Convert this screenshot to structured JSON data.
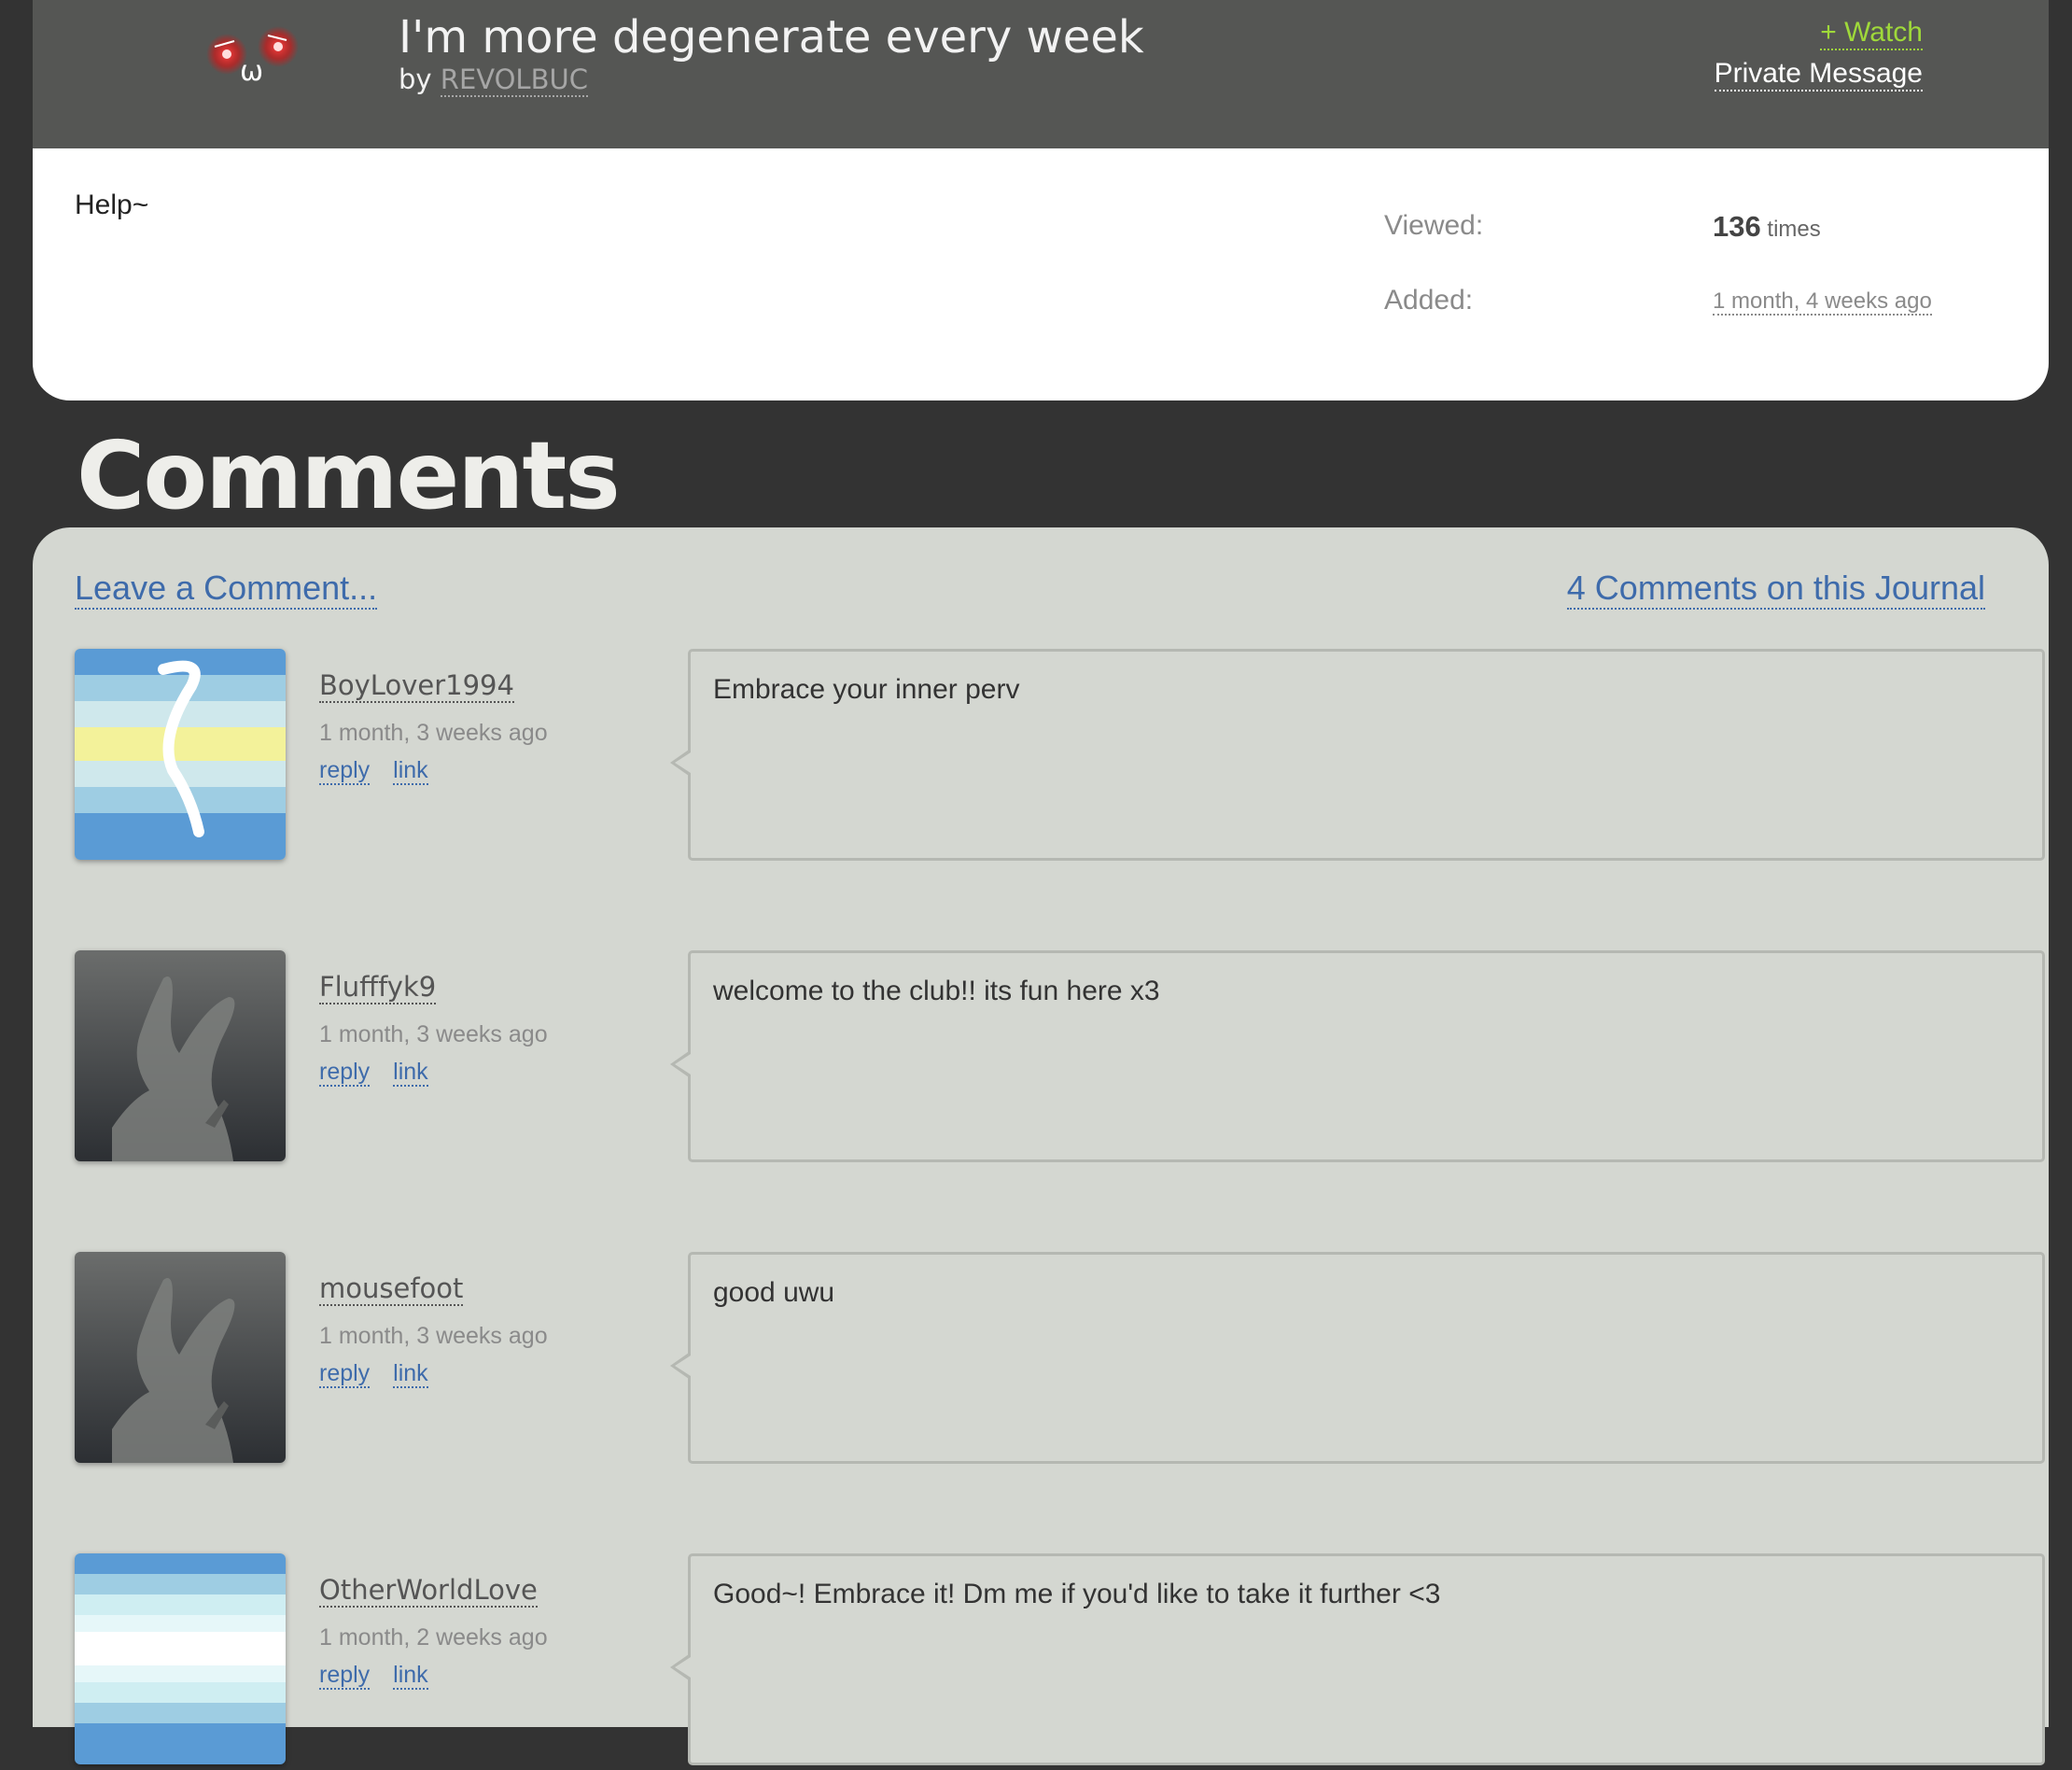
{
  "journal": {
    "title": "I'm more degenerate every week",
    "by_label": "by",
    "author": "REVOLBUC",
    "watch_label": "+ Watch",
    "pm_label": "Private Message",
    "body": "Help~",
    "viewed_label": "Viewed:",
    "viewed_count": "136",
    "viewed_unit": "times",
    "added_label": "Added:",
    "added_value": "1 month, 4 weeks ago",
    "avatar_text": "ω"
  },
  "comments_section": {
    "heading": "Comments",
    "leave_label": "Leave a Comment...",
    "count_label": "4 Comments on this Journal",
    "items": [
      {
        "user": "BoyLover1994",
        "date": "1 month, 3 weeks ago",
        "reply": "reply",
        "link": "link",
        "text": "Embrace your inner perv",
        "avatar": "flag-icon-stripes-yellow"
      },
      {
        "user": "Flufffyk9",
        "date": "1 month, 3 weeks ago",
        "reply": "reply",
        "link": "link",
        "text": "welcome to the club!! its fun here x3",
        "avatar": "default-avatar-icon"
      },
      {
        "user": "mousefoot",
        "date": "1 month, 3 weeks ago",
        "reply": "reply",
        "link": "link",
        "text": "good uwu",
        "avatar": "default-avatar-icon"
      },
      {
        "user": "OtherWorldLove",
        "date": "1 month, 2 weeks ago",
        "reply": "reply",
        "link": "link",
        "text": "Good~! Embrace it! Dm me if you'd like to take it further <3",
        "avatar": "flag-icon-stripes-blue"
      }
    ]
  },
  "colors": {
    "header_bg": "#555654",
    "page_bg": "#333333",
    "panel_bg": "#d4d7d1",
    "link": "#3e6bab",
    "watch": "#9fd93a"
  }
}
